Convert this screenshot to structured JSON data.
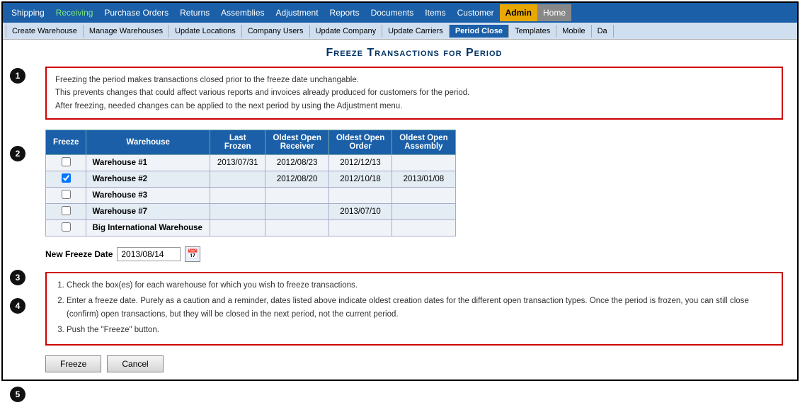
{
  "topNav": {
    "items": [
      {
        "label": "Shipping",
        "id": "shipping"
      },
      {
        "label": "Receiving",
        "id": "receiving",
        "class": "receiving"
      },
      {
        "label": "Purchase Orders",
        "id": "purchase-orders"
      },
      {
        "label": "Returns",
        "id": "returns"
      },
      {
        "label": "Assemblies",
        "id": "assemblies"
      },
      {
        "label": "Adjustment",
        "id": "adjustment"
      },
      {
        "label": "Reports",
        "id": "reports"
      },
      {
        "label": "Documents",
        "id": "documents"
      },
      {
        "label": "Items",
        "id": "items"
      },
      {
        "label": "Customer",
        "id": "customer"
      },
      {
        "label": "Admin",
        "id": "admin",
        "class": "admin-active"
      },
      {
        "label": "Home",
        "id": "home",
        "class": "home-active"
      }
    ]
  },
  "subNav": {
    "items": [
      {
        "label": "Create Warehouse",
        "id": "create-warehouse"
      },
      {
        "label": "Manage Warehouses",
        "id": "manage-warehouses"
      },
      {
        "label": "Update Locations",
        "id": "update-locations"
      },
      {
        "label": "Company Users",
        "id": "company-users"
      },
      {
        "label": "Update Company",
        "id": "update-company"
      },
      {
        "label": "Update Carriers",
        "id": "update-carriers"
      },
      {
        "label": "Period Close",
        "id": "period-close",
        "class": "period-close"
      },
      {
        "label": "Templates",
        "id": "templates"
      },
      {
        "label": "Mobile",
        "id": "mobile"
      },
      {
        "label": "Da",
        "id": "da"
      }
    ]
  },
  "pageTitle": "Freeze Transactions for Period",
  "infoBox": {
    "lines": [
      "Freezing the period makes transactions closed prior to the freeze date unchangable.",
      "This prevents changes that could affect various reports and invoices already produced for customers for the period.",
      "After freezing, needed changes can be applied to the next period by using the Adjustment menu."
    ]
  },
  "table": {
    "headers": [
      "Freeze",
      "Warehouse",
      "Last Frozen",
      "Oldest Open Receiver",
      "Oldest Open Order",
      "Oldest Open Assembly"
    ],
    "rows": [
      {
        "checked": false,
        "warehouse": "Warehouse #1",
        "lastFrozen": "2013/07/31",
        "oldestReceiver": "2012/08/23",
        "oldestOrder": "2012/12/13",
        "oldestAssembly": ""
      },
      {
        "checked": true,
        "warehouse": "Warehouse #2",
        "lastFrozen": "",
        "oldestReceiver": "2012/08/20",
        "oldestOrder": "2012/10/18",
        "oldestAssembly": "2013/01/08"
      },
      {
        "checked": false,
        "warehouse": "Warehouse #3",
        "lastFrozen": "",
        "oldestReceiver": "",
        "oldestOrder": "",
        "oldestAssembly": ""
      },
      {
        "checked": false,
        "warehouse": "Warehouse #7",
        "lastFrozen": "",
        "oldestReceiver": "",
        "oldestOrder": "2013/07/10",
        "oldestAssembly": ""
      },
      {
        "checked": false,
        "warehouse": "Big International Warehouse",
        "lastFrozen": "",
        "oldestReceiver": "",
        "oldestOrder": "",
        "oldestAssembly": ""
      }
    ]
  },
  "freezeDate": {
    "label": "New Freeze Date",
    "value": "2013/08/14",
    "calendarIcon": "📅"
  },
  "instructions": {
    "items": [
      "Check the box(es) for each warehouse for which you wish to freeze transactions.",
      "Enter a freeze date. Purely as a caution and a reminder, dates listed above indicate oldest creation dates for the different open transaction types. Once the period is frozen, you can still close (confirm) open transactions, but they will be closed in the next period, not the current period.",
      "Push the \"Freeze\" button."
    ]
  },
  "buttons": {
    "freeze": "Freeze",
    "cancel": "Cancel"
  },
  "annotations": [
    "1",
    "2",
    "3",
    "4",
    "5"
  ]
}
